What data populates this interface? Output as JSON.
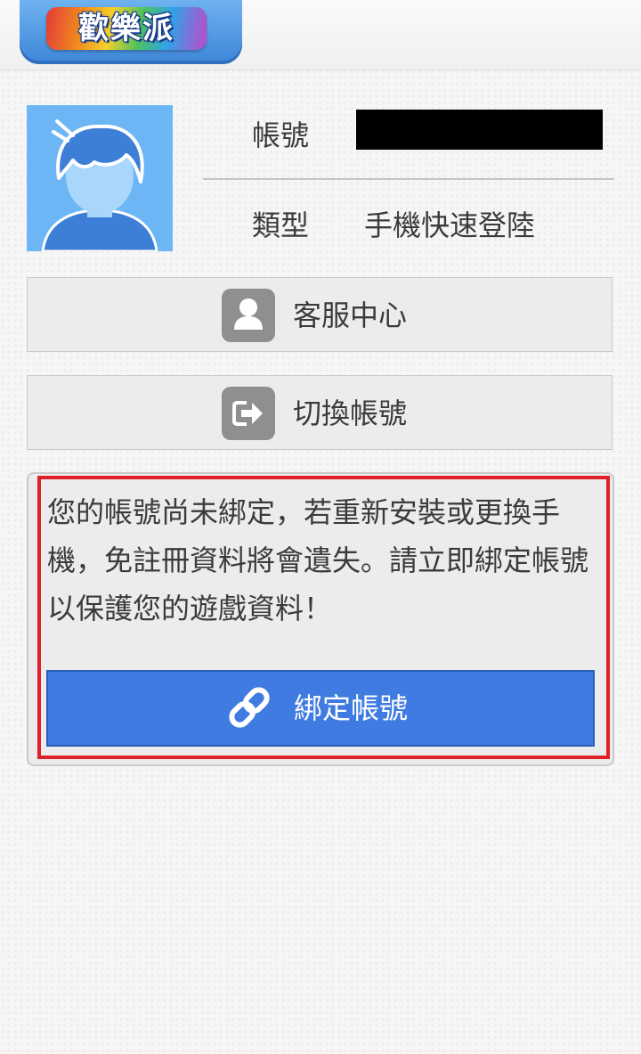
{
  "header": {
    "logo_text": "歡樂派"
  },
  "profile": {
    "account_label": "帳號",
    "type_label": "類型",
    "type_value": "手機快速登陸"
  },
  "menu": {
    "customer_service_label": "客服中心",
    "switch_account_label": "切換帳號"
  },
  "warning": {
    "message": "您的帳號尚未綁定，若重新安裝或更換手機，免註冊資料將會遺失。請立即綁定帳號以保護您的遊戲資料！",
    "bind_button_label": "綁定帳號"
  },
  "colors": {
    "accent_blue": "#3f7be0",
    "alert_red": "#e02027",
    "avatar_bg": "#6cb6f5"
  },
  "icons": {
    "customer_service": "person-icon",
    "switch_account": "logout-icon",
    "bind": "link-icon"
  }
}
